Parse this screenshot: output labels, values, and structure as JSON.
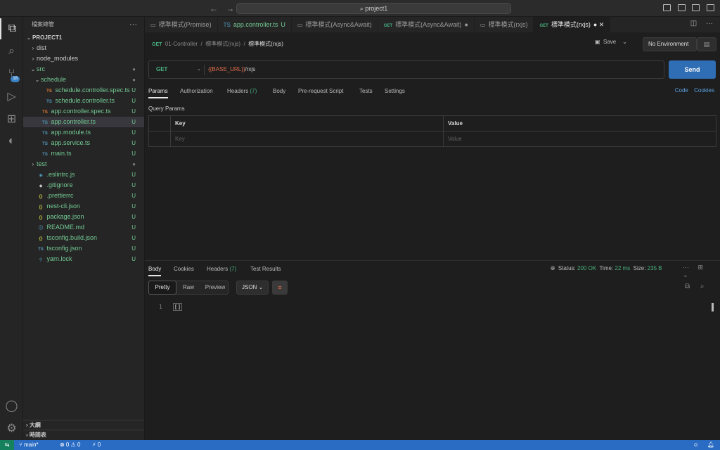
{
  "titlebar": {
    "back": "←",
    "forward": "→",
    "search_text": "⌕ project1"
  },
  "activity": {
    "explorer": "⧉",
    "search": "⌕",
    "scm": "⑂",
    "scm_badge": "18",
    "run": "▷",
    "extensions": "⊞",
    "postman": "◐",
    "account": "◯",
    "settings": "⚙"
  },
  "sidebar": {
    "title": "檔案總管",
    "more": "···",
    "items": [
      {
        "label": "PROJECT1",
        "chev": "⌄",
        "indent": 0,
        "color": "plain",
        "icon": "",
        "status": "",
        "bold": true
      },
      {
        "label": "dist",
        "chev": "›",
        "indent": 1,
        "color": "plain",
        "icon": "",
        "status": ""
      },
      {
        "label": "node_modules",
        "chev": "›",
        "indent": 1,
        "color": "plain",
        "icon": "",
        "status": ""
      },
      {
        "label": "src",
        "chev": "⌄",
        "indent": 1,
        "color": "green",
        "icon": "",
        "status": "●",
        "status_color": "dot"
      },
      {
        "label": "schedule",
        "chev": "⌄",
        "indent": 2,
        "color": "green",
        "icon": "",
        "status": "●",
        "status_color": "dot"
      },
      {
        "label": "schedule.controller.spec.ts",
        "chev": "",
        "indent": 3,
        "color": "green",
        "icon": "TS",
        "icon_color": "ts-orange",
        "status": "U",
        "status_color": "green"
      },
      {
        "label": "schedule.controller.ts",
        "chev": "",
        "indent": 3,
        "color": "green",
        "icon": "TS",
        "icon_color": "ts-blue",
        "status": "U",
        "status_color": "green"
      },
      {
        "label": "app.controller.spec.ts",
        "chev": "",
        "indent": 2,
        "color": "green",
        "icon": "TS",
        "icon_color": "ts-orange",
        "status": "U",
        "status_color": "green"
      },
      {
        "label": "app.controller.ts",
        "chev": "",
        "indent": 2,
        "color": "green",
        "icon": "TS",
        "icon_color": "ts-blue",
        "status": "U",
        "status_color": "green",
        "selected": true
      },
      {
        "label": "app.module.ts",
        "chev": "",
        "indent": 2,
        "color": "green",
        "icon": "TS",
        "icon_color": "ts-blue",
        "status": "U",
        "status_color": "green"
      },
      {
        "label": "app.service.ts",
        "chev": "",
        "indent": 2,
        "color": "green",
        "icon": "TS",
        "icon_color": "ts-blue",
        "status": "U",
        "status_color": "green"
      },
      {
        "label": "main.ts",
        "chev": "",
        "indent": 2,
        "color": "green",
        "icon": "TS",
        "icon_color": "ts-blue",
        "status": "U",
        "status_color": "green"
      },
      {
        "label": "test",
        "chev": "›",
        "indent": 1,
        "color": "green",
        "icon": "",
        "status": "●",
        "status_color": "dot"
      },
      {
        "label": ".eslintrc.js",
        "chev": "",
        "indent": 1,
        "color": "green",
        "icon": "◉",
        "icon_color": "ts-blue",
        "status": "U",
        "status_color": "green"
      },
      {
        "label": ".gitignore",
        "chev": "",
        "indent": 1,
        "color": "green",
        "icon": "◆",
        "icon_color": "plain",
        "status": "U",
        "status_color": "green"
      },
      {
        "label": ".prettierrc",
        "chev": "",
        "indent": 1,
        "color": "green",
        "icon": "{}",
        "icon_color": "json-y",
        "status": "U",
        "status_color": "green"
      },
      {
        "label": "nest-cli.json",
        "chev": "",
        "indent": 1,
        "color": "green",
        "icon": "{}",
        "icon_color": "json-y",
        "status": "U",
        "status_color": "green"
      },
      {
        "label": "package.json",
        "chev": "",
        "indent": 1,
        "color": "green",
        "icon": "{}",
        "icon_color": "json-y",
        "status": "U",
        "status_color": "green"
      },
      {
        "label": "README.md",
        "chev": "",
        "indent": 1,
        "color": "green",
        "icon": "ⓘ",
        "icon_color": "ts-blue",
        "status": "U",
        "status_color": "green"
      },
      {
        "label": "tsconfig.build.json",
        "chev": "",
        "indent": 1,
        "color": "green",
        "icon": "{}",
        "icon_color": "json-y",
        "status": "U",
        "status_color": "green"
      },
      {
        "label": "tsconfig.json",
        "chev": "",
        "indent": 1,
        "color": "green",
        "icon": "TS",
        "icon_color": "ts-blue",
        "status": "U",
        "status_color": "green"
      },
      {
        "label": "yarn.lock",
        "chev": "",
        "indent": 1,
        "color": "green",
        "icon": "⚲",
        "icon_color": "ts-blue",
        "status": "U",
        "status_color": "green"
      }
    ],
    "outline_label": "大綱",
    "timeline_label": "時間表"
  },
  "tabs": [
    {
      "icon": "▭",
      "label": "標準模式(Promise)",
      "active": false,
      "suffix": ""
    },
    {
      "icon": "TS",
      "label": "app.controller.ts",
      "active": false,
      "suffix": "U",
      "green": true
    },
    {
      "icon": "▭",
      "label": "標準模式(Async&Await)",
      "active": false,
      "suffix": ""
    },
    {
      "icon": "GET",
      "label": "標準模式(Async&Await)",
      "active": false,
      "suffix": "●"
    },
    {
      "icon": "▭",
      "label": "標準模式(rxjs)",
      "active": false,
      "suffix": ""
    },
    {
      "icon": "GET",
      "label": "標準模式(rxjs)",
      "active": true,
      "suffix": "● ✕"
    }
  ],
  "editor": {
    "breadcrumb": {
      "icon": "GET",
      "collection": "01-Controller",
      "folder": "標準模式(rxjs)",
      "current": "標準模式(rxjs)",
      "sep": "/"
    },
    "save_label": "Save",
    "env_label": "No Environment",
    "request": {
      "method": "GET",
      "url_var": "{{BASE_URL}}",
      "url_rest": "/rxjs",
      "send_label": "Send"
    },
    "req_tabs": {
      "params": "Params",
      "authorization": "Authorization",
      "headers": "Headers",
      "headers_count": "(7)",
      "body": "Body",
      "prerequest": "Pre-request Script",
      "tests": "Tests",
      "settings": "Settings",
      "code": "Code",
      "cookies": "Cookies"
    },
    "query_params": {
      "title": "Query Params",
      "key_header": "Key",
      "value_header": "Value",
      "key_placeholder": "Key",
      "value_placeholder": "Value"
    },
    "response": {
      "tabs": {
        "body": "Body",
        "cookies": "Cookies",
        "headers": "Headers",
        "headers_count": "(7)",
        "test_results": "Test Results"
      },
      "status_label": "Status:",
      "status_value": "200 OK",
      "time_label": "Time:",
      "time_value": "22 ms",
      "size_label": "Size:",
      "size_value": "235 B",
      "format_pretty": "Pretty",
      "format_raw": "Raw",
      "format_preview": "Preview",
      "lang": "JSON",
      "line_number": "1",
      "body_text": "[]"
    }
  },
  "statusbar": {
    "remote": "⇆",
    "branch": "main*",
    "branch_icon": "⑂",
    "problems": "⊗ 0 ⚠ 0",
    "ports": "⚡ 0"
  }
}
